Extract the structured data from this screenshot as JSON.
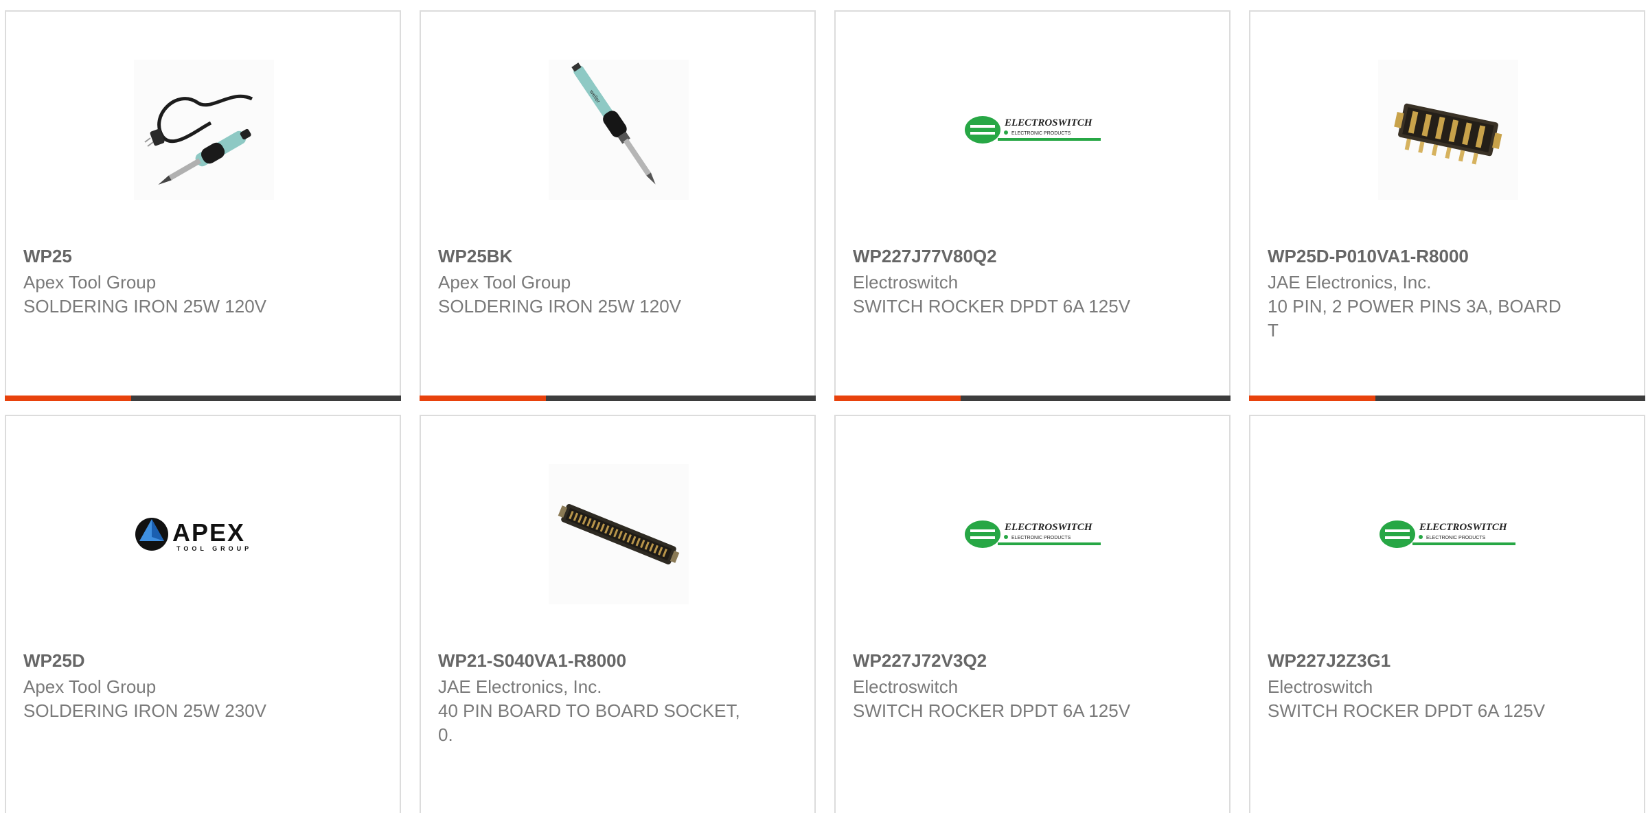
{
  "colors": {
    "accent": "#e8420c",
    "bar": "#3d3d3d",
    "border": "#dcdcdc",
    "electroswitch_green": "#27a745",
    "apex_blue": "#1b5fb0"
  },
  "products": [
    {
      "part": "WP25",
      "manufacturer": "Apex Tool Group",
      "description": "SOLDERING IRON 25W 120V",
      "image": "soldering-iron-with-cord-icon"
    },
    {
      "part": "WP25BK",
      "manufacturer": "Apex Tool Group",
      "description": "SOLDERING IRON 25W 120V",
      "image": "soldering-iron-icon"
    },
    {
      "part": "WP227J77V80Q2",
      "manufacturer": "Electroswitch",
      "description": "SWITCH ROCKER DPDT 6A 125V",
      "image": "electroswitch-logo",
      "logo_text": "ELECTROSWITCH",
      "logo_subtext": "ELECTRONIC PRODUCTS"
    },
    {
      "part": "WP25D-P010VA1-R8000",
      "manufacturer": "JAE Electronics, Inc.",
      "description": "10 PIN, 2 POWER PINS 3A, BOARD T",
      "image": "connector-10-pin-icon"
    },
    {
      "part": "WP25D",
      "manufacturer": "Apex Tool Group",
      "description": "SOLDERING IRON 25W 230V",
      "image": "apex-logo",
      "logo_text": "APEX",
      "logo_subtext": "TOOL GROUP"
    },
    {
      "part": "WP21-S040VA1-R8000",
      "manufacturer": "JAE Electronics, Inc.",
      "description": "40 PIN BOARD TO BOARD SOCKET, 0.",
      "image": "connector-40-pin-icon"
    },
    {
      "part": "WP227J72V3Q2",
      "manufacturer": "Electroswitch",
      "description": "SWITCH ROCKER DPDT 6A 125V",
      "image": "electroswitch-logo",
      "logo_text": "ELECTROSWITCH",
      "logo_subtext": "ELECTRONIC PRODUCTS"
    },
    {
      "part": "WP227J2Z3G1",
      "manufacturer": "Electroswitch",
      "description": "SWITCH ROCKER DPDT 6A 125V",
      "image": "electroswitch-logo",
      "logo_text": "ELECTROSWITCH",
      "logo_subtext": "ELECTRONIC PRODUCTS"
    }
  ]
}
